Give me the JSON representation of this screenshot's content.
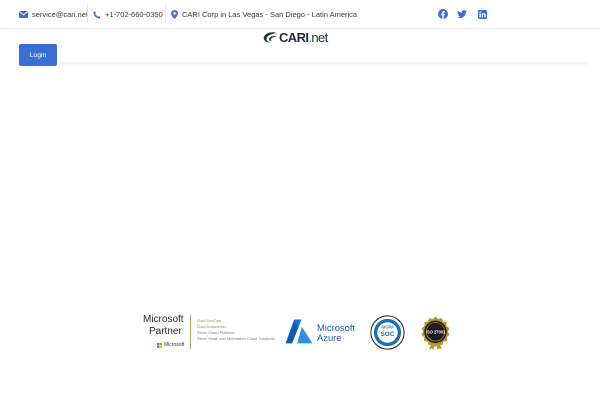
{
  "topbar": {
    "email": "service@cari.net",
    "phone": "+1-702-660-0350",
    "locations": "CARI Corp in Las Vegas - San Diego - Latin America",
    "social": [
      {
        "name": "facebook-icon",
        "color": "#3b6fd8"
      },
      {
        "name": "twitter-icon",
        "color": "#3b6fd8"
      },
      {
        "name": "linkedin-icon",
        "color": "#3b6fd8"
      }
    ]
  },
  "logo": {
    "brand": "CARI",
    "suffix": ".net"
  },
  "nav": {
    "login_label": "Login"
  },
  "partners": {
    "microsoft": {
      "word1": "Microsoft",
      "word2": "Partner",
      "small": "Microsoft",
      "competencies": [
        "Gold DevOps",
        "Gold Datacenter",
        "Silver Cloud Platform",
        "Silver Small and Midmarket Cloud Solutions"
      ]
    },
    "azure": {
      "line1": "Microsoft",
      "line2": "Azure"
    },
    "aicpa": {
      "top": "AICPA",
      "mid": "SOC"
    },
    "iso": {
      "label": "ISO 27001"
    }
  },
  "colors": {
    "accent": "#3b6fd8",
    "logo": "#1d2e44",
    "gold": "#a38c3e",
    "azure": "#1c5bb0"
  }
}
